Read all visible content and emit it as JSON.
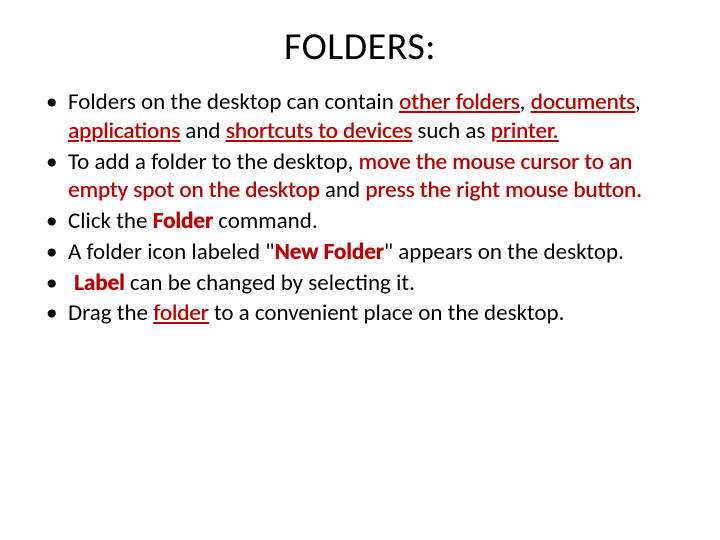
{
  "title": "FOLDERS:",
  "b1": {
    "t1": "Folders on the desktop can contain ",
    "h1": "other folders",
    "t2": ", ",
    "h2": "documents",
    "t3": ", ",
    "h3": "applications",
    "t4": " and ",
    "h4": "shortcuts to devices",
    "t5": " such as ",
    "h5": "printer.",
    "t6": ""
  },
  "b2": {
    "t1": "To add a folder to the desktop, ",
    "h1": "move the mouse cursor to an empty spot on the desktop",
    "t2": " and ",
    "h2": "press the right mouse button.",
    "t3": ""
  },
  "b3": {
    "t1": "Click the ",
    "h1": "Folder",
    "t2": " command."
  },
  "b4": {
    "t1": "A folder icon labeled \"",
    "h1": "New Folder",
    "t2": "\" appears on the desktop."
  },
  "b5": {
    "h1": "Label",
    "t1": " can be changed by selecting it."
  },
  "b6": {
    "t1": " Drag the ",
    "h1": "folder",
    "t2": " to a convenient place on the desktop."
  }
}
